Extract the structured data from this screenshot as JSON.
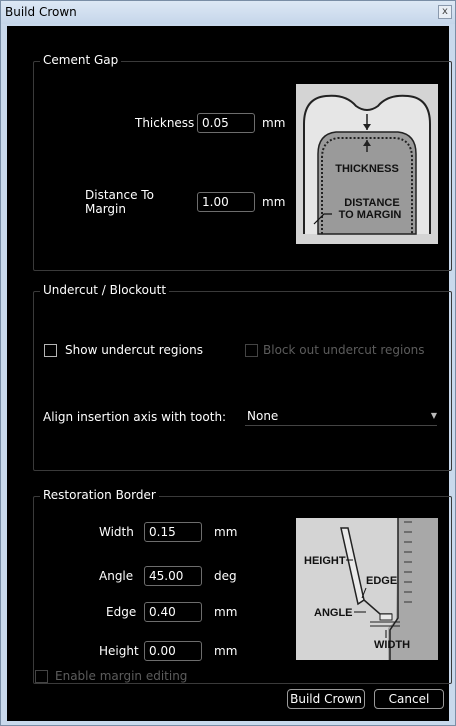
{
  "window": {
    "title": "Build Crown",
    "close_glyph": "x"
  },
  "cement_gap": {
    "legend": "Cement Gap",
    "thickness_label": "Thickness",
    "thickness_value": "0.05",
    "thickness_unit": "mm",
    "distance_label": "Distance To Margin",
    "distance_value": "1.00",
    "distance_unit": "mm",
    "diagram": {
      "thickness_text": "THICKNESS",
      "distance_text_1": "DISTANCE",
      "distance_text_2": "TO MARGIN"
    }
  },
  "undercut": {
    "legend": "Undercut / Blockoutt",
    "show_undercut_label": "Show undercut regions",
    "block_out_label": "Block out undercut regions",
    "align_label": "Align insertion axis with tooth:",
    "align_value": "None"
  },
  "restoration": {
    "legend": "Restoration Border",
    "width_label": "Width",
    "width_value": "0.15",
    "width_unit": "mm",
    "angle_label": "Angle",
    "angle_value": "45.00",
    "angle_unit": "deg",
    "edge_label": "Edge",
    "edge_value": "0.40",
    "edge_unit": "mm",
    "height_label": "Height",
    "height_value": "0.00",
    "height_unit": "mm",
    "diagram": {
      "height_text": "HEIGHT",
      "edge_text": "EDGE",
      "angle_text": "ANGLE",
      "width_text": "WIDTH"
    }
  },
  "footer": {
    "enable_margin_label": "Enable margin editing",
    "build_button": "Build Crown",
    "cancel_button": "Cancel"
  }
}
